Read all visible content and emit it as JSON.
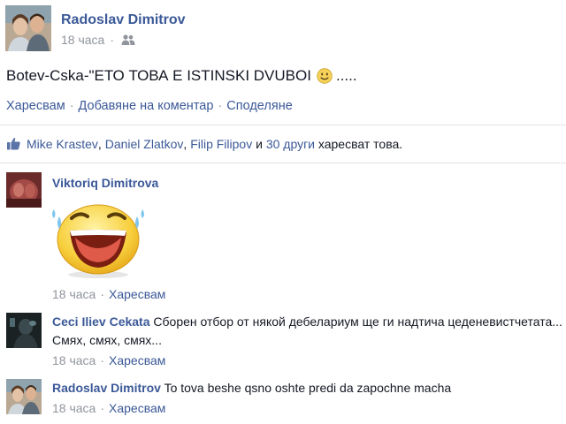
{
  "post": {
    "author": "Radoslav Dimitrov",
    "time": "18 часа",
    "audience_icon": "friends-icon",
    "text_before": "Botev-Cska-\"ЕТО ТОВА Е ISTINSKI DVUBOI",
    "text_after": ".....",
    "emoticon": "smile-emoticon"
  },
  "actions": {
    "like": "Харесвам",
    "comment": "Добавяне на коментар",
    "share": "Споделяне",
    "separator": "·"
  },
  "likes": {
    "icon": "thumbs-up-icon",
    "names": [
      "Mike Krastev",
      "Daniel Zlatkov",
      "Filip Filipov"
    ],
    "comma": ",",
    "conjunction": "и",
    "others": "30 други",
    "suffix": "харесват това."
  },
  "comments": [
    {
      "author": "Viktoriq Dimitrova",
      "text": "",
      "sticker": "laughing-sticker",
      "time": "18 часа",
      "like": "Харесвам"
    },
    {
      "author": "Ceci Iliev Cekata",
      "text": "Сборен отбор от някой дебелариум ще ги надтича цеденевистчетата... Смях, смях, смях...",
      "time": "18 часа",
      "like": "Харесвам"
    },
    {
      "author": "Radoslav Dimitrov",
      "text": "To tova beshe qsno oshte predi da zapochne macha",
      "time": "18 часа",
      "like": "Харесвам"
    }
  ],
  "colors": {
    "link": "#3b5998",
    "meta": "#90949c",
    "text": "#141823",
    "divider": "#e1e2e3"
  }
}
